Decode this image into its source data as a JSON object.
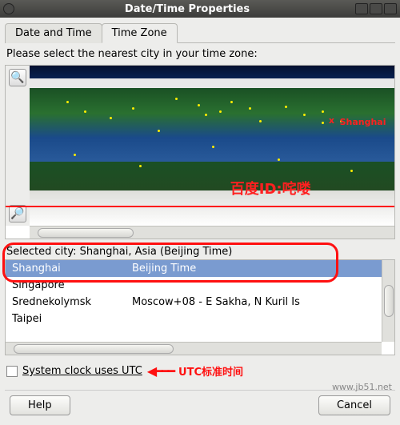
{
  "window": {
    "title": "Date/Time Properties"
  },
  "tabs": {
    "date_time": "Date and Time",
    "time_zone": "Time Zone",
    "active": "time_zone"
  },
  "prompt": "Please select the nearest city in your time zone:",
  "map": {
    "marker_label": "Shanghai",
    "overlay_text": "百度ID:咤喽"
  },
  "selected_city_label": "Selected city: Shanghai, Asia (Beijing Time)",
  "city_list": [
    {
      "name": "Shanghai",
      "tz": "Beijing Time",
      "selected": true
    },
    {
      "name": "Singapore",
      "tz": "",
      "selected": false
    },
    {
      "name": "Srednekolymsk",
      "tz": "Moscow+08 - E Sakha, N Kuril Is",
      "selected": false
    },
    {
      "name": "Taipei",
      "tz": "",
      "selected": false
    }
  ],
  "utc": {
    "checkbox_label": "System clock uses UTC",
    "annotation": "UTC标准时间"
  },
  "buttons": {
    "help": "Help",
    "cancel": "Cancel"
  },
  "watermark": "www.jb51.net"
}
